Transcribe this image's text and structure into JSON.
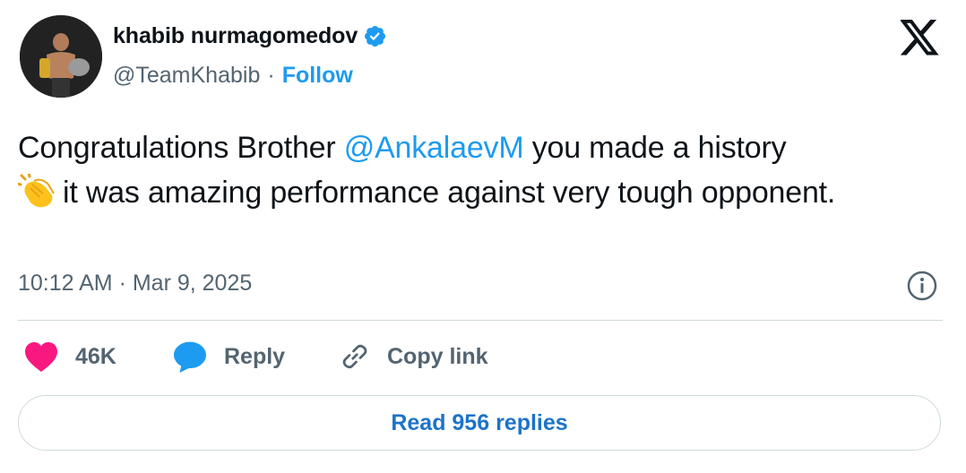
{
  "author": {
    "display_name": "khabib nurmagomedov",
    "handle": "@TeamKhabib",
    "separator": "·",
    "follow_label": "Follow",
    "verified": true
  },
  "tweet": {
    "text_before_mention": "Congratulations Brother ",
    "mention": "@AnkalaevM",
    "text_after_mention": " you made a history ",
    "text_after_emoji": "it was amazing performance against very tough opponent.",
    "emoji": "clapping-hands",
    "timestamp": "10:12 AM · Mar 9, 2025"
  },
  "actions": {
    "like_count": "46K",
    "reply_label": "Reply",
    "copy_label": "Copy link"
  },
  "read_replies_label": "Read 956 replies",
  "colors": {
    "accent": "#1d9bf0",
    "like": "#f91880",
    "muted": "#536471",
    "text": "#0f1419",
    "border": "#cfd9de"
  }
}
